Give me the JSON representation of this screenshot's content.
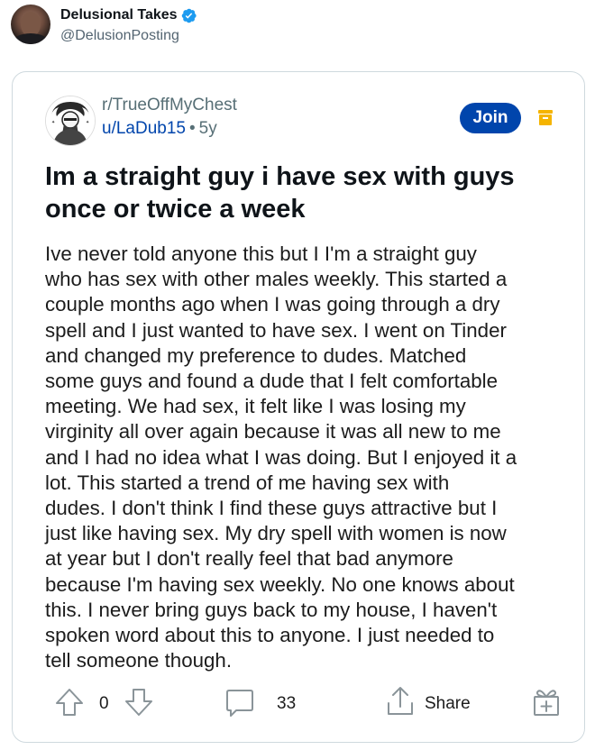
{
  "tweet": {
    "display_name": "Delusional Takes",
    "handle": "@DelusionPosting",
    "verified": true
  },
  "reddit_post": {
    "subreddit": "r/TrueOffMyChest",
    "username": "u/LaDub15",
    "separator": "•",
    "age": "5y",
    "join_label": "Join",
    "title": "Im a straight guy i have sex with guys once or twice a week",
    "body_lines": [
      "Ive never told anyone this but I I'm a straight guy",
      "who has sex with other males weekly. This started a",
      "couple months ago when I was going through a dry",
      "spell and I just wanted to have sex. I went on Tinder",
      "and changed my preference to dudes. Matched",
      "some guys and found a dude that I felt comfortable",
      "meeting. We had sex, it felt like I was losing my",
      "virginity all over again because it was all new to me",
      "and I had no idea what I was doing. But I enjoyed it a",
      "lot. This started a trend of me having sex with",
      "dudes. I don't think I find these guys attractive but I",
      "just like having sex. My dry spell with women is now",
      "at year but I don't really feel that bad anymore",
      "because I'm having sex weekly. No one knows about",
      "this. I never bring guys back to my house, I haven't",
      "spoken word about this to anyone. I just needed to",
      "tell someone though."
    ],
    "vote_count": "0",
    "comment_count": "33",
    "share_label": "Share"
  },
  "icons": {
    "verified": "verified-badge-icon",
    "save": "save-icon",
    "upvote": "upvote-arrow-icon",
    "downvote": "downvote-arrow-icon",
    "comment": "comment-bubble-icon",
    "share": "share-upload-icon",
    "award": "award-gift-icon"
  },
  "colors": {
    "verified_blue": "#1d9bf0",
    "join_button": "#0045ac",
    "username_link": "#0045ac",
    "save_icon": "#f5b400",
    "muted_text": "#576f76"
  }
}
